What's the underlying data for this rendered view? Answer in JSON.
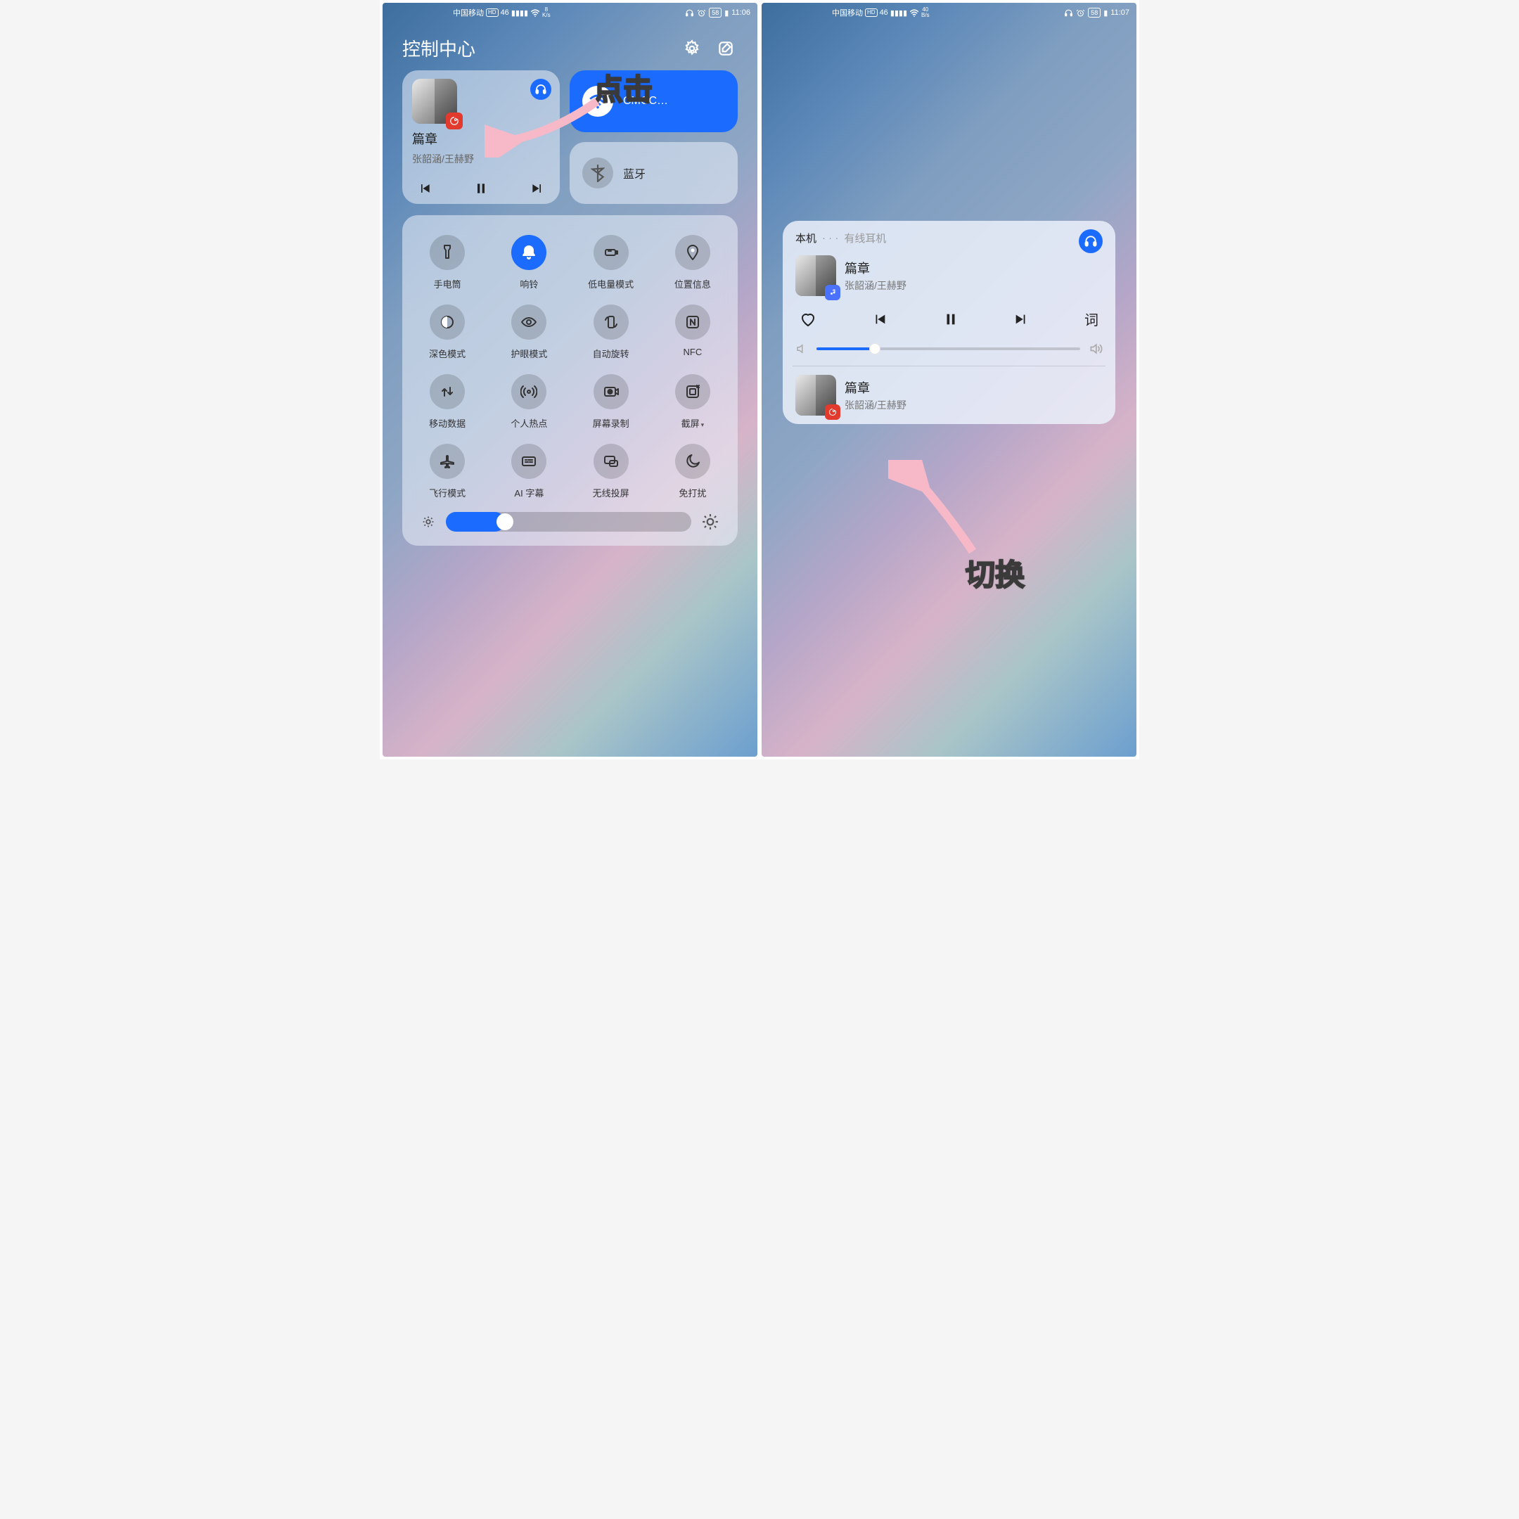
{
  "left": {
    "status": {
      "carrier": "中国移动",
      "hd": "HD",
      "netTag": "46",
      "speed_val": "8",
      "speed_unit": "K/s",
      "battery": "58",
      "time": "11:06"
    },
    "header": {
      "title": "控制中心"
    },
    "music": {
      "song": "篇章",
      "artist": "张韶涵/王赫野"
    },
    "wifi": {
      "label": "CMCC…"
    },
    "bt": {
      "label": "蓝牙"
    },
    "toggles": [
      [
        {
          "id": "flashlight",
          "label": "手电筒"
        },
        {
          "id": "ringer",
          "label": "响铃",
          "on": true
        },
        {
          "id": "low-power",
          "label": "低电量模式"
        },
        {
          "id": "location",
          "label": "位置信息"
        }
      ],
      [
        {
          "id": "dark-mode",
          "label": "深色模式"
        },
        {
          "id": "eye-comfort",
          "label": "护眼模式"
        },
        {
          "id": "auto-rotate",
          "label": "自动旋转"
        },
        {
          "id": "nfc",
          "label": "NFC"
        }
      ],
      [
        {
          "id": "mobile-data",
          "label": "移动数据"
        },
        {
          "id": "hotspot",
          "label": "个人热点"
        },
        {
          "id": "screen-record",
          "label": "屏幕录制"
        },
        {
          "id": "screenshot",
          "label": "截屏",
          "chev": true
        }
      ],
      [
        {
          "id": "airplane",
          "label": "飞行模式"
        },
        {
          "id": "ai-subtitle",
          "label": "AI 字幕"
        },
        {
          "id": "wireless-proj",
          "label": "无线投屏"
        },
        {
          "id": "dnd",
          "label": "免打扰"
        }
      ]
    ],
    "annotation": "点击"
  },
  "right": {
    "status": {
      "carrier": "中国移动",
      "hd": "HD",
      "netTag": "46",
      "speed_val": "40",
      "speed_unit": "B/s",
      "battery": "58",
      "time": "11:07"
    },
    "mp": {
      "tab_local": "本机",
      "tab_wired": "有线耳机",
      "now_song": "篇章",
      "now_artist": "张韶涵/王赫野",
      "lyrics_btn": "词",
      "queue_song": "篇章",
      "queue_artist": "张韶涵/王赫野"
    },
    "annotation": "切换"
  }
}
